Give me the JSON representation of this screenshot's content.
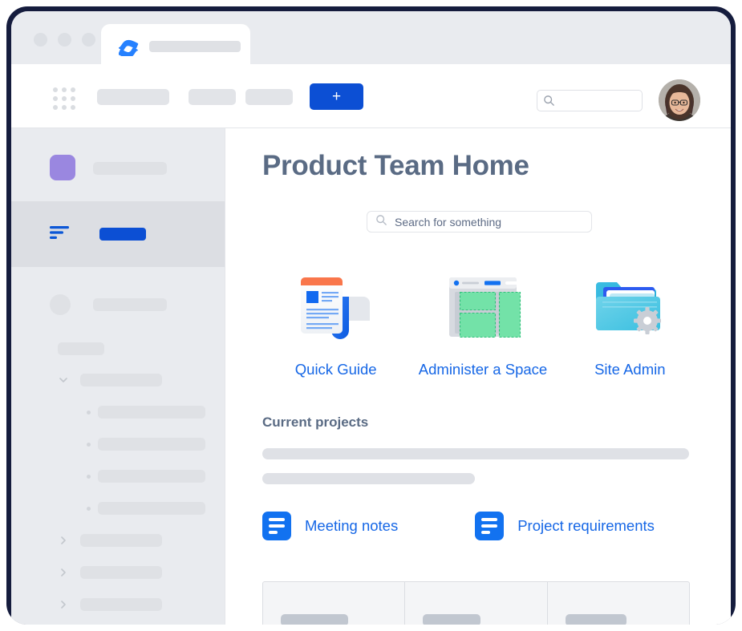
{
  "window": {
    "dots": [
      "minimize-dot",
      "maximize-dot",
      "close-dot"
    ],
    "tab": {
      "logo": "confluence-logo",
      "title_placeholder": ""
    }
  },
  "navbar": {
    "app_switcher_icon": "app-switcher-grid-icon",
    "nav_placeholders": [
      "",
      "",
      ""
    ],
    "create_label": "+",
    "search_icon": "search-icon",
    "search_value": "",
    "avatar": "user-avatar"
  },
  "sidebar": {
    "space": {
      "avatar_color": "#9a87e0",
      "name_placeholder": ""
    },
    "active_item": {
      "icon": "content-list-icon",
      "label_placeholder": "",
      "accent": "#0c4fd4"
    },
    "items": [
      {
        "type": "user",
        "icon": "avatar-circle-icon",
        "label": ""
      },
      {
        "type": "section",
        "label": ""
      },
      {
        "type": "group",
        "icon": "chevron-down-icon",
        "label": "",
        "expanded": true
      },
      {
        "type": "child",
        "icon": "bullet-icon",
        "label": ""
      },
      {
        "type": "child",
        "icon": "bullet-icon",
        "label": ""
      },
      {
        "type": "child",
        "icon": "bullet-icon",
        "label": ""
      },
      {
        "type": "child",
        "icon": "bullet-icon",
        "label": ""
      },
      {
        "type": "group",
        "icon": "chevron-right-icon",
        "label": "",
        "expanded": false
      },
      {
        "type": "group",
        "icon": "chevron-right-icon",
        "label": "",
        "expanded": false
      },
      {
        "type": "group",
        "icon": "chevron-right-icon",
        "label": "",
        "expanded": false
      }
    ]
  },
  "main": {
    "title": "Product Team Home",
    "search": {
      "icon": "search-icon",
      "placeholder": "Search for something",
      "value": ""
    },
    "shortcuts": [
      {
        "label": "Quick Guide",
        "icon": "document-guide-icon"
      },
      {
        "label": "Administer a Space",
        "icon": "space-layout-icon"
      },
      {
        "label": "Site Admin",
        "icon": "folder-gear-icon"
      }
    ],
    "projects": {
      "heading": "Current projects",
      "placeholder_bars": [
        "",
        ""
      ]
    },
    "page_links": [
      {
        "label": "Meeting notes",
        "icon": "page-lines-icon"
      },
      {
        "label": "Project requirements",
        "icon": "page-lines-icon"
      }
    ],
    "table": {
      "columns": [
        "",
        "",
        ""
      ]
    }
  },
  "colors": {
    "frame": "#151c3d",
    "chrome_bg": "#e9ebef",
    "sidebar_bg": "#e9ebef",
    "sidebar_active_bg": "#dcdee3",
    "accent_blue": "#0c4fd4",
    "link_blue": "#1667e6",
    "title_gray": "#5a6b84",
    "placeholder_gray": "#dfe1e6"
  }
}
